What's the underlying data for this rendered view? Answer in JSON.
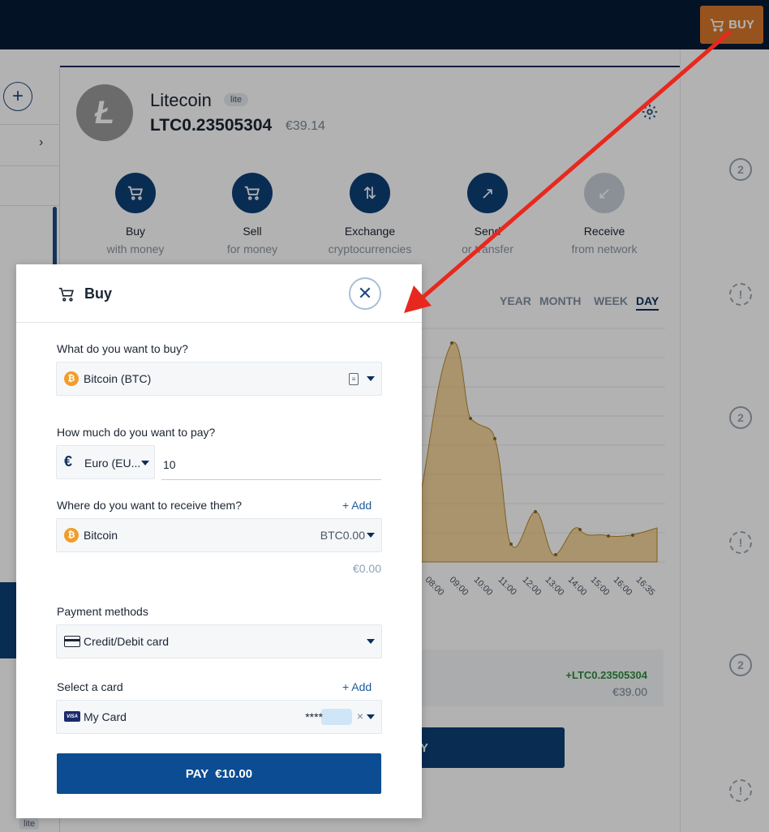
{
  "topbar": {
    "buy_label": "BUY"
  },
  "sidebar": {
    "lite_label": "lite"
  },
  "coin": {
    "name": "Litecoin",
    "badge": "lite",
    "balance": "LTC0.23505304",
    "fiat": "€39.14"
  },
  "actions": [
    {
      "label": "Buy",
      "sub": "with money",
      "icon": "cart-icon"
    },
    {
      "label": "Sell",
      "sub": "for money",
      "icon": "cart-icon"
    },
    {
      "label": "Exchange",
      "sub": "cryptocurrencies",
      "icon": "swap-arrows-icon"
    },
    {
      "label": "Send",
      "sub": "or transfer",
      "icon": "arrow-up-right-icon"
    },
    {
      "label": "Receive",
      "sub": "from network",
      "icon": "arrow-down-left-icon"
    }
  ],
  "periods": [
    "YEAR",
    "MONTH",
    "WEEK",
    "DAY"
  ],
  "active_period": "DAY",
  "chart_data": {
    "type": "area",
    "x": [
      "08:00",
      "09:00",
      "10:00",
      "11:00",
      "12:00",
      "13:00",
      "14:00",
      "15:00",
      "16:00",
      "16:35"
    ],
    "color": "#e8b24d"
  },
  "balance_box": {
    "ltc": "+LTC0.23505304",
    "eur": "€39.00"
  },
  "background_button_letter": "Y",
  "modal": {
    "title": "Buy",
    "buy_label": "What do you want to buy?",
    "buy_value": "Bitcoin (BTC)",
    "pay_label": "How much do you want to pay?",
    "currency_value": "Euro (EU...",
    "amount_value": "10",
    "receive_label": "Where do you want to receive them?",
    "receive_add": "+ Add",
    "receive_wallet": "Bitcoin",
    "receive_amount": "BTC0.00",
    "receive_fiat": "€0.00",
    "payment_label": "Payment methods",
    "payment_value": "Credit/Debit card",
    "card_label": "Select a card",
    "card_add": "+ Add",
    "card_name": "My Card",
    "card_masked": "****",
    "card_clear": "×",
    "pay_button_prefix": "PAY",
    "pay_button_amount": "€10.00"
  },
  "colors": {
    "topbar": "#061a35",
    "accent": "#0b4c92",
    "buy_button": "#d8782a",
    "bitcoin": "#f29d28",
    "arrow": "#e8281e"
  }
}
